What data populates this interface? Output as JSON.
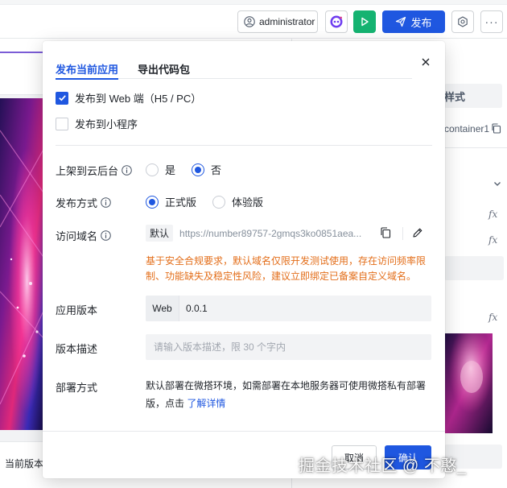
{
  "header": {
    "user_name": "administrator",
    "publish_label": "发布"
  },
  "left_panel": {
    "bottom_label": "当前版本"
  },
  "right_panel": {
    "style_tab": "样式",
    "component_id": "container1",
    "fx_symbol": "fx"
  },
  "dialog": {
    "tabs": [
      {
        "label": "发布当前应用",
        "active": true
      },
      {
        "label": "导出代码包",
        "active": false
      }
    ],
    "targets": [
      {
        "label": "发布到 Web 端（H5 / PC）",
        "checked": true
      },
      {
        "label": "发布到小程序",
        "checked": false
      }
    ],
    "cloud_listing": {
      "label": "上架到云后台",
      "options": [
        {
          "label": "是",
          "selected": false
        },
        {
          "label": "否",
          "selected": true
        }
      ]
    },
    "publish_mode": {
      "label": "发布方式",
      "options": [
        {
          "label": "正式版",
          "selected": true
        },
        {
          "label": "体验版",
          "selected": false
        }
      ]
    },
    "domain": {
      "label": "访问域名",
      "tag": "默认",
      "url": "https://number89757-2gmqs3ko0851aea...",
      "warning": "基于安全合规要求，默认域名仅限开发测试使用，存在访问频率限制、功能缺失及稳定性风险，建议立即绑定已备案自定义域名。"
    },
    "version": {
      "label": "应用版本",
      "prefix": "Web",
      "value": "0.0.1"
    },
    "description": {
      "label": "版本描述",
      "placeholder": "请输入版本描述，限 30 个字内"
    },
    "deploy": {
      "label": "部署方式",
      "text": "默认部署在微搭环境，如需部署在本地服务器可使用微搭私有部署版，点击",
      "link": "了解详情"
    },
    "buttons": {
      "cancel": "取消",
      "confirm": "确认"
    }
  },
  "watermark": "掘金技术社区 @ 不憨_",
  "colors": {
    "primary": "#1f57e0",
    "warning": "#e36e1a",
    "run_green": "#15b371"
  }
}
